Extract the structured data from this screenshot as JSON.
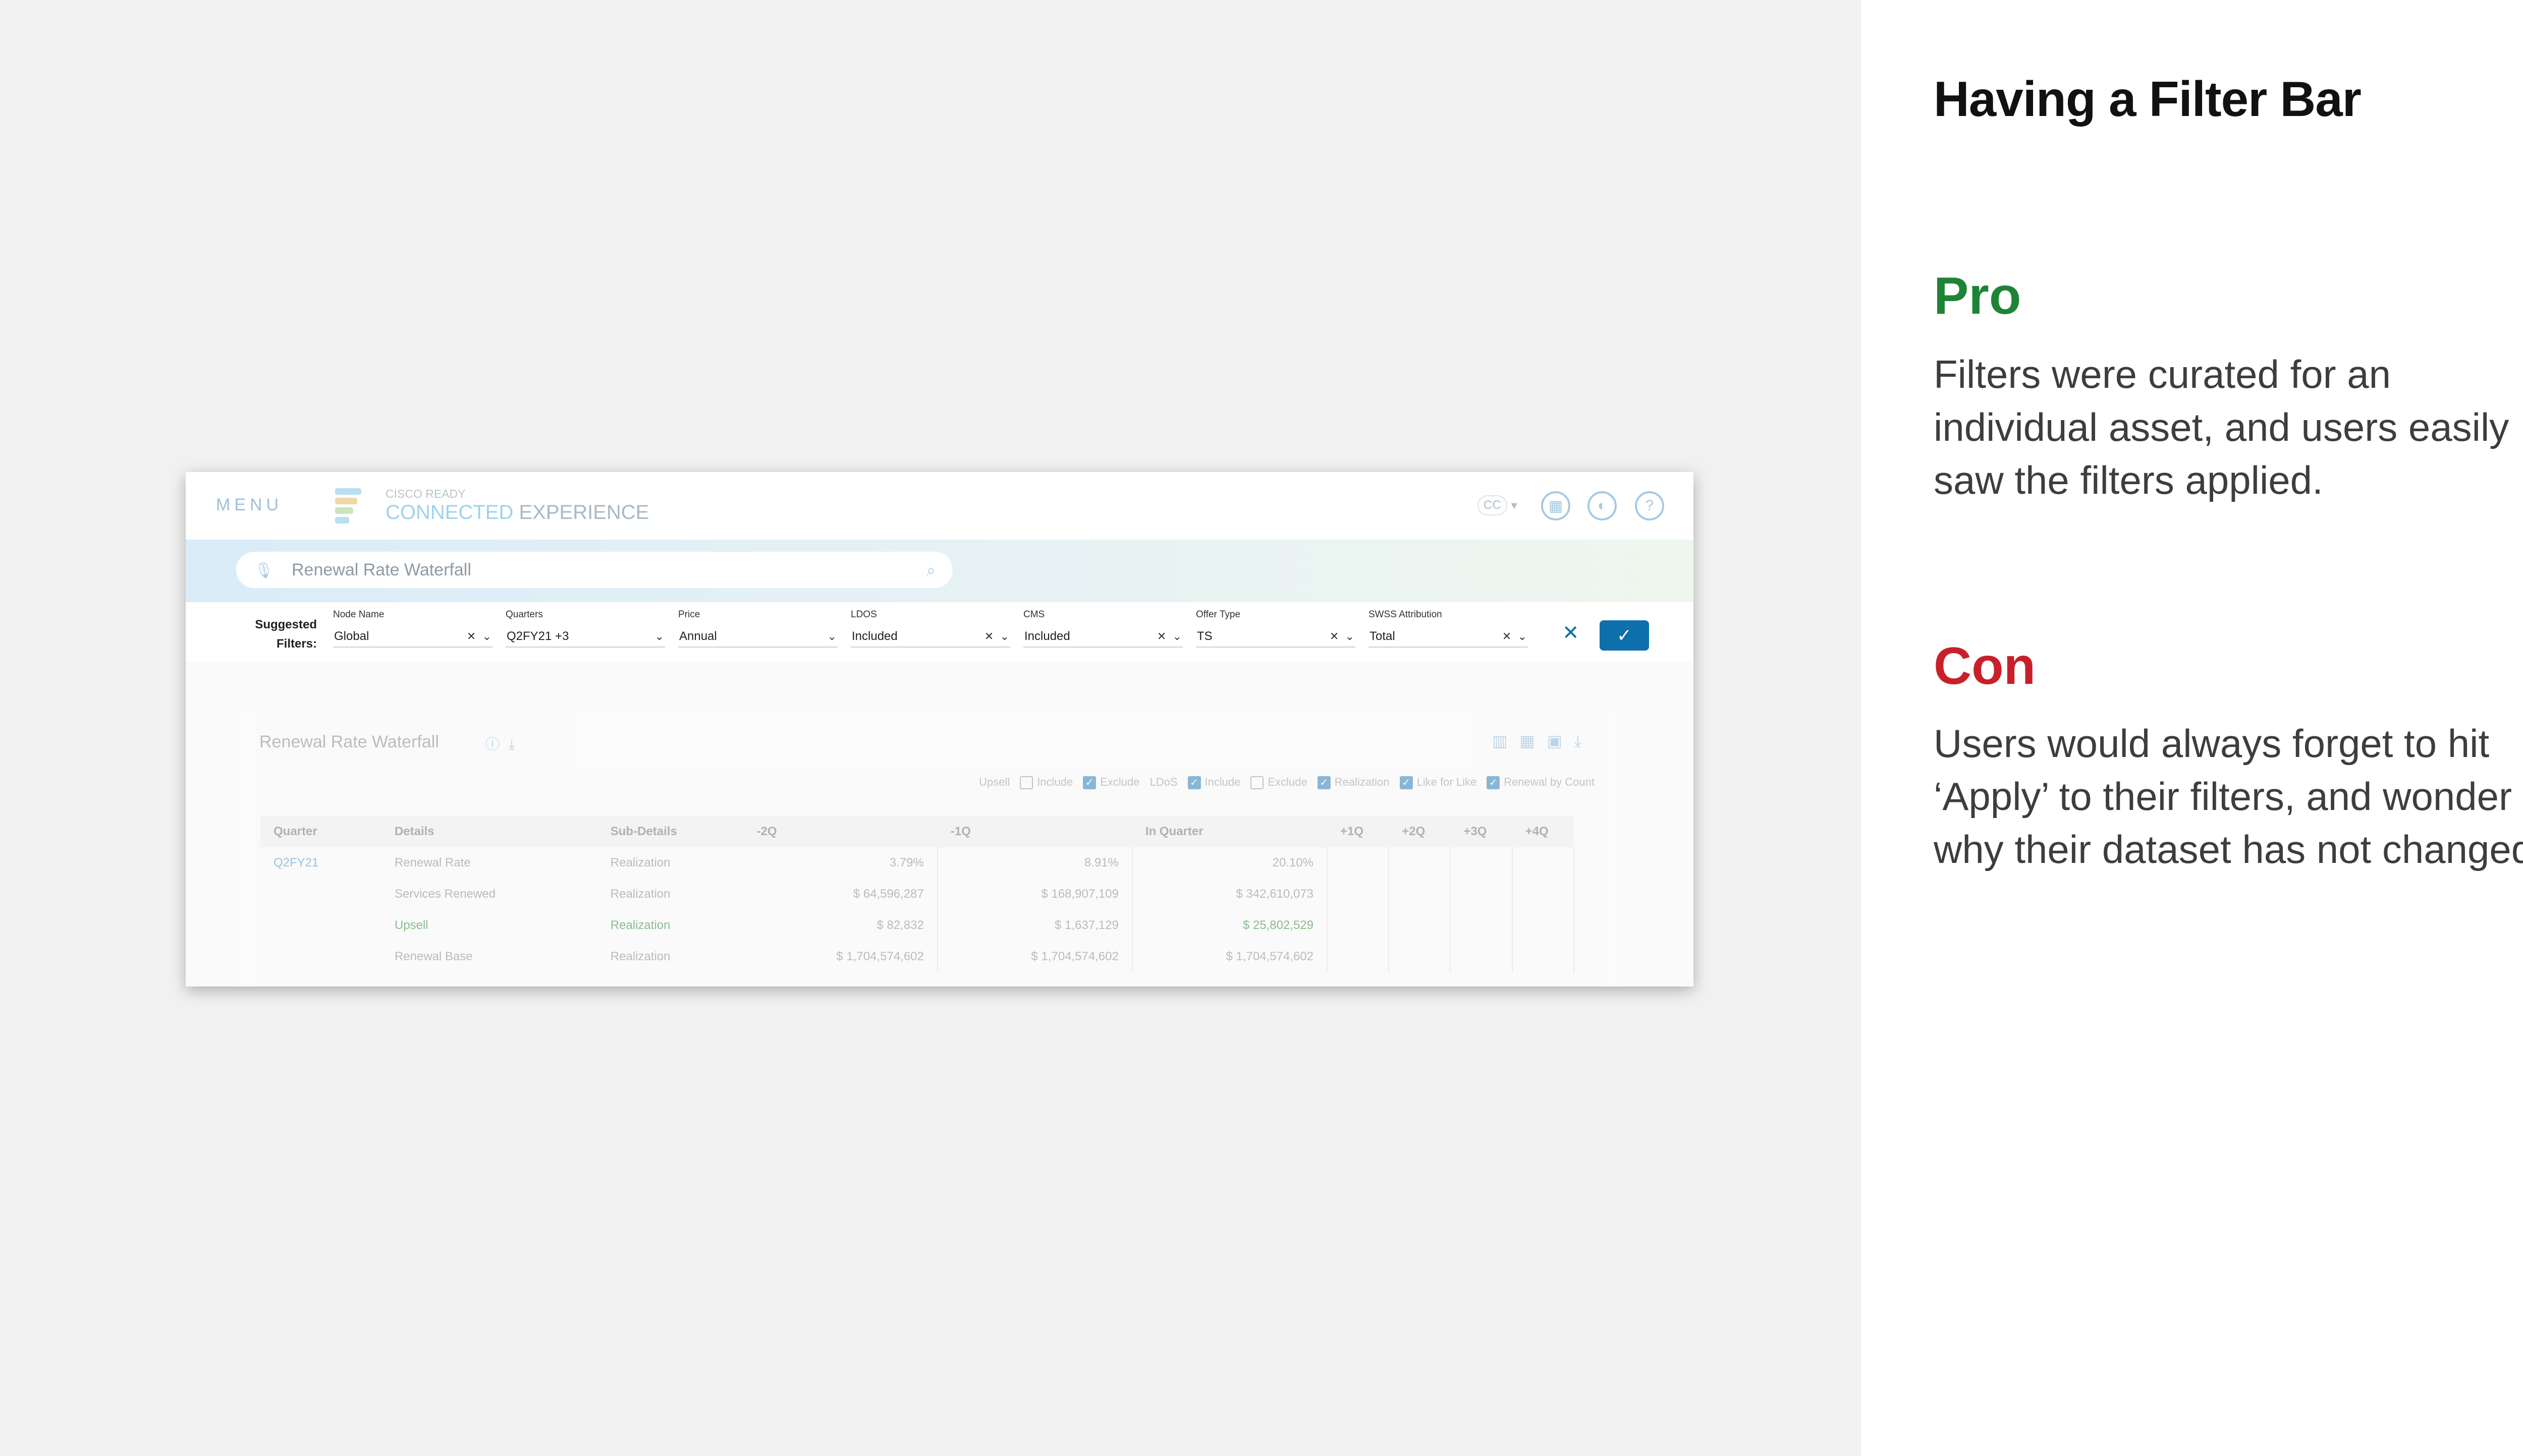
{
  "slide": {
    "title": "Having a Filter Bar",
    "pro": {
      "heading": "Pro",
      "text": "Filters were curated for an individual asset, and users easily saw the filters applied."
    },
    "con": {
      "heading": "Con",
      "text": "Users would always forget to hit ‘Apply’ to their filters, and wonder why their dataset has not changed."
    },
    "colors": {
      "pro": "#1f8337",
      "con": "#c8202a",
      "accent": "#0d6fac"
    }
  },
  "app": {
    "menu_label": "MENU",
    "brand_small": "CISCO READY",
    "brand_part1": "CONNECTED",
    "brand_part2": "EXPERIENCE",
    "lang": "CC",
    "search": {
      "value": "Renewal Rate Waterfall"
    },
    "filters": {
      "suggested_label_1": "Suggested",
      "suggested_label_2": "Filters:",
      "groups": [
        {
          "label": "Node Name",
          "value": "Global",
          "clearable": true
        },
        {
          "label": "Quarters",
          "value": "Q2FY21  +3",
          "clearable": false
        },
        {
          "label": "Price",
          "value": "Annual",
          "clearable": false
        },
        {
          "label": "LDOS",
          "value": "Included",
          "clearable": true
        },
        {
          "label": "CMS",
          "value": "Included",
          "clearable": true
        },
        {
          "label": "Offer Type",
          "value": "TS",
          "clearable": true
        },
        {
          "label": "SWSS Attribution",
          "value": "Total",
          "clearable": true
        }
      ]
    },
    "widget": {
      "title": "Renewal Rate Waterfall",
      "toggles": [
        {
          "label": "Upsell",
          "type": "label"
        },
        {
          "label": "Include",
          "checked": false
        },
        {
          "label": "Exclude",
          "checked": true
        },
        {
          "label": "LDoS",
          "type": "label"
        },
        {
          "label": "Include",
          "checked": true
        },
        {
          "label": "Exclude",
          "checked": false
        },
        {
          "label": "Realization",
          "checked": true
        },
        {
          "label": "Like for Like",
          "checked": true
        },
        {
          "label": "Renewal by Count",
          "checked": true
        }
      ],
      "table": {
        "headers": [
          "Quarter",
          "Details",
          "Sub-Details",
          "-2Q",
          "-1Q",
          "In Quarter",
          "+1Q",
          "+2Q",
          "+3Q",
          "+4Q"
        ],
        "rows": [
          [
            "Q2FY21",
            "Renewal Rate",
            "Realization",
            "3.79%",
            "8.91%",
            "20.10%",
            "",
            "",
            "",
            ""
          ],
          [
            "",
            "Services Renewed",
            "Realization",
            "$ 64,596,287",
            "$ 168,907,109",
            "$ 342,610,073",
            "",
            "",
            "",
            ""
          ],
          [
            "",
            "Upsell",
            "Realization",
            "$ 82,832",
            "$ 1,637,129",
            "$ 25,802,529",
            "",
            "",
            "",
            ""
          ],
          [
            "",
            "Renewal Base",
            "Realization",
            "$ 1,704,574,602",
            "$ 1,704,574,602",
            "$ 1,704,574,602",
            "",
            "",
            "",
            ""
          ]
        ]
      }
    }
  }
}
